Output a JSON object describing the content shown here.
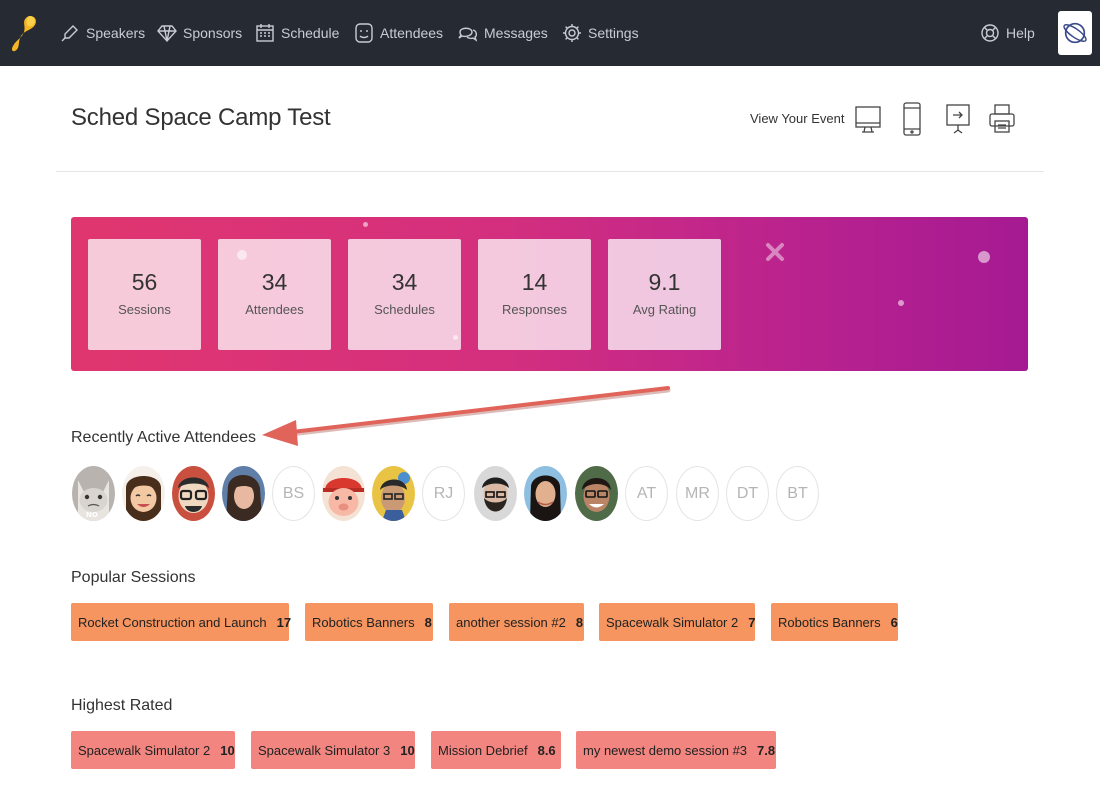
{
  "nav": {
    "items": [
      {
        "label": "Speakers",
        "icon": "microphone-icon"
      },
      {
        "label": "Sponsors",
        "icon": "diamond-icon"
      },
      {
        "label": "Schedule",
        "icon": "calendar-icon"
      },
      {
        "label": "Attendees",
        "icon": "smiley-icon"
      },
      {
        "label": "Messages",
        "icon": "chat-bubbles-icon"
      },
      {
        "label": "Settings",
        "icon": "gear-icon"
      }
    ],
    "help_label": "Help"
  },
  "header": {
    "title": "Sched Space Camp Test",
    "view_event_label": "View Your Event"
  },
  "stats": [
    {
      "value": "56",
      "label": "Sessions"
    },
    {
      "value": "34",
      "label": "Attendees"
    },
    {
      "value": "34",
      "label": "Schedules"
    },
    {
      "value": "14",
      "label": "Responses"
    },
    {
      "value": "9.1",
      "label": "Avg Rating"
    }
  ],
  "recent_attendees": {
    "title": "Recently Active Attendees",
    "initials": [
      "BS",
      "RJ",
      "AT",
      "MR",
      "DT",
      "BT"
    ],
    "photo_note": "NO"
  },
  "popular_sessions": {
    "title": "Popular Sessions",
    "items": [
      {
        "name": "Rocket Construction and Launch",
        "count": "17"
      },
      {
        "name": "Robotics Banners",
        "count": "8"
      },
      {
        "name": "another session #2",
        "count": "8"
      },
      {
        "name": "Spacewalk Simulator 2",
        "count": "7"
      },
      {
        "name": "Robotics Banners",
        "count": "6"
      }
    ]
  },
  "highest_rated": {
    "title": "Highest Rated",
    "items": [
      {
        "name": "Spacewalk Simulator 2",
        "rating": "10"
      },
      {
        "name": "Spacewalk Simulator 3",
        "rating": "10"
      },
      {
        "name": "Mission Debrief",
        "rating": "8.6"
      },
      {
        "name": "my newest demo session #3",
        "rating": "7.8"
      }
    ]
  },
  "colors": {
    "nav_bg": "#262a32",
    "banner_start": "#e0366f",
    "banner_end": "#a51a92",
    "popular_pill": "#f6955f",
    "rated_pill": "#f2857f",
    "annotation_arrow": "#e0645a"
  }
}
